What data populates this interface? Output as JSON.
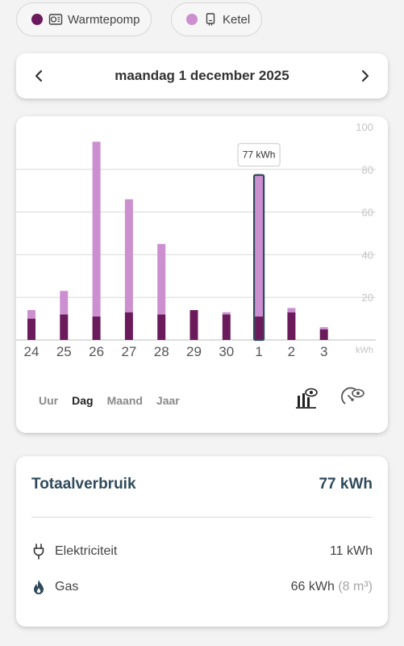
{
  "legend": [
    {
      "label": "Warmtepomp",
      "color": "#6b1a5c",
      "icon": "heatpump-icon"
    },
    {
      "label": "Ketel",
      "color": "#cc8fd0",
      "icon": "boiler-icon"
    }
  ],
  "datebar": {
    "title": "maandag 1 december 2025",
    "prev_icon": "chevron-left-icon",
    "next_icon": "chevron-right-icon"
  },
  "chart_data": {
    "type": "bar",
    "stacked": true,
    "categories": [
      "24",
      "25",
      "26",
      "27",
      "28",
      "29",
      "30",
      "1",
      "2",
      "3"
    ],
    "series": [
      {
        "name": "Warmtepomp",
        "color": "#6b1a5c",
        "values": [
          10,
          12,
          11,
          13,
          12,
          14,
          12,
          11,
          13,
          5
        ]
      },
      {
        "name": "Ketel",
        "color": "#cc8fd0",
        "values": [
          4,
          11,
          82,
          53,
          33,
          0,
          1,
          66,
          2,
          1
        ]
      }
    ],
    "yticks": [
      "100",
      "80",
      "60",
      "40",
      "20"
    ],
    "ylim": [
      0,
      100
    ],
    "yunit": "kWh",
    "grid": true,
    "highlight_index": 7,
    "tooltip": "77 kWh"
  },
  "tabs": [
    {
      "label": "Uur",
      "active": false
    },
    {
      "label": "Dag",
      "active": true
    },
    {
      "label": "Maand",
      "active": false
    },
    {
      "label": "Jaar",
      "active": false
    }
  ],
  "view_icons": [
    "bar-chart-view-icon",
    "gauge-view-icon"
  ],
  "totals": {
    "title": "Totaalverbruik",
    "value": "77 kWh",
    "electricity_label": "Elektriciteit",
    "electricity_value": "11 kWh",
    "gas_label": "Gas",
    "gas_value": "66 kWh",
    "gas_volume": "(8 m³)"
  }
}
